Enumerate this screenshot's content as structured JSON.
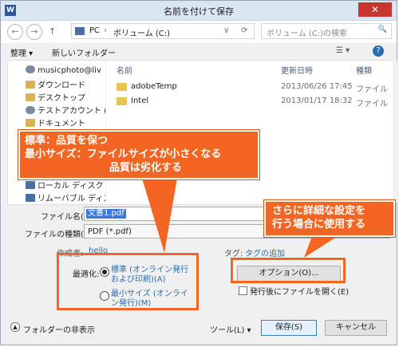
{
  "titlebar": {
    "app_icon": "W",
    "title": "名前を付けて保存",
    "close": "✕"
  },
  "nav": {
    "back": "←",
    "forward": "→",
    "up": "↑",
    "path_pc": "PC",
    "path_sep": "›",
    "path_volume": "ボリューム (C:)",
    "path_chev": "∨",
    "refresh": "⟳",
    "search_placeholder": "ボリューム (C:)の検索",
    "search_icon": "🔍"
  },
  "toolbar": {
    "organize": "整理 ▾",
    "new_folder": "新しいフォルダー",
    "view": "☰ ▾",
    "help": "?"
  },
  "sidebar": {
    "items": [
      {
        "label": "musicphoto@liv",
        "icon": "user"
      },
      {
        "label": "ダウンロード",
        "icon": "folder"
      },
      {
        "label": "デスクトップ",
        "icon": "folder"
      },
      {
        "label": "テストアカウント (he",
        "icon": "user"
      },
      {
        "label": "ドキュメント",
        "icon": "folder"
      },
      {
        "label": "ローカル ディスク (L",
        "icon": "pc"
      },
      {
        "label": "リムーバブル ディスク",
        "icon": "pc"
      }
    ]
  },
  "columns": {
    "name": "名前",
    "date": "更新日時",
    "type": "種類"
  },
  "files": [
    {
      "name": "adobeTemp",
      "date": "2013/06/26 17:45",
      "type": "ファイル"
    },
    {
      "name": "Intel",
      "date": "2013/01/17 18:32",
      "type": "ファイル"
    }
  ],
  "form": {
    "filename_label": "ファイル名(N):",
    "filename_value": "文書1.pdf",
    "filetype_label": "ファイルの種類(T):",
    "filetype_value": "PDF (*.pdf)",
    "author_label": "作成者:",
    "author_value": "hello",
    "tags_label": "タグ:",
    "tags_value": "タグの追加",
    "optimize_label": "最適化:",
    "opt_standard": "標準 (オンライン発行および印刷)(A)",
    "opt_minimum": "最小サイズ (オンライン発行)(M)",
    "options_button": "オプション(O)...",
    "open_after": "発行後にファイルを開く(E)"
  },
  "bottom": {
    "hide_folders": "フォルダーの非表示",
    "tools": "ツール(L) ▾",
    "save": "保存(S)",
    "cancel": "キャンセル"
  },
  "callouts": {
    "left_line1": "標準：品質を保つ",
    "left_line2": "最小サイズ：ファイルサイズが小さくなる",
    "left_line3": "品質は劣化する",
    "right_line1": "さらに詳細な設定を",
    "right_line2": "行う場合に使用する"
  },
  "colors": {
    "callout": "#f26522",
    "accent": "#2b6cb0"
  }
}
